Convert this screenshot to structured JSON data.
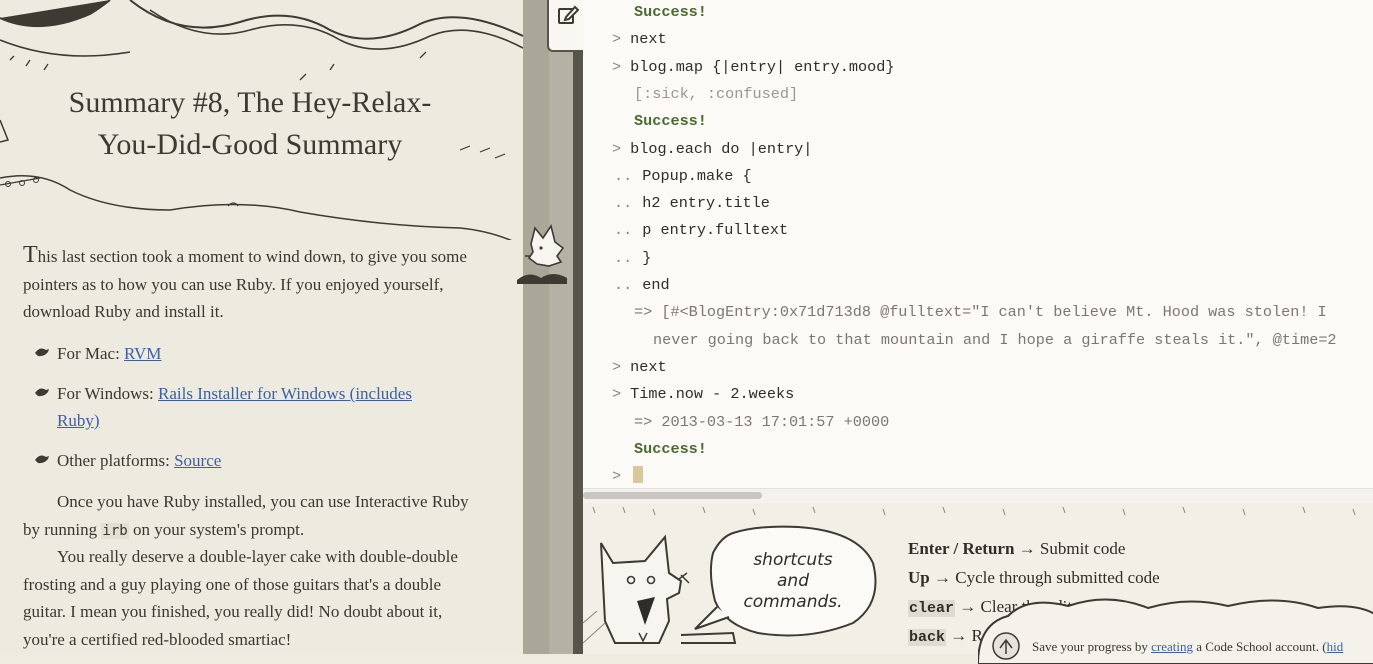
{
  "lesson": {
    "title_line1": "Summary #8, The Hey-Relax-",
    "title_line2": "You-Did-Good Summary",
    "intro_dropcap": "T",
    "intro_rest": "his last section took a moment to wind down, to give you some pointers as to how you can use Ruby. If you enjoyed yourself, download Ruby and install it.",
    "bullets": [
      {
        "prefix": "For Mac: ",
        "link": "RVM"
      },
      {
        "prefix": "For Windows: ",
        "link": "Rails Installer for Windows (includes Ruby)"
      },
      {
        "prefix": "Other platforms: ",
        "link": "Source"
      }
    ],
    "para2_before": "Once you have Ruby installed, you can use Interactive Ruby by running ",
    "para2_code": "irb",
    "para2_after": " on your system's prompt.",
    "para3": "You really deserve a double-layer cake with double-double frosting and a guy playing one of those guitars that's a double guitar. I mean you finished, you really did! No doubt about it, you're a certified red-blooded smartiac!"
  },
  "console": {
    "lines": [
      {
        "kind": "ok",
        "text": "Success!"
      },
      {
        "kind": "input",
        "prompt": ">",
        "text": "next"
      },
      {
        "kind": "input",
        "prompt": ">",
        "text": "blog.map {|entry| entry.mood}"
      },
      {
        "kind": "out",
        "text": "[:sick, :confused]"
      },
      {
        "kind": "ok",
        "text": "Success!"
      },
      {
        "kind": "input",
        "prompt": ">",
        "text": "blog.each do |entry|"
      },
      {
        "kind": "cont",
        "prompt": "..",
        "text": "Popup.make {"
      },
      {
        "kind": "cont",
        "prompt": "..",
        "text": "h2 entry.title"
      },
      {
        "kind": "cont",
        "prompt": "..",
        "text": "p entry.fulltext"
      },
      {
        "kind": "cont",
        "prompt": "..",
        "text": "}"
      },
      {
        "kind": "cont",
        "prompt": "..",
        "text": "end"
      },
      {
        "kind": "res",
        "text": "=> [#<BlogEntry:0x71d713d8 @fulltext=\"I can't believe Mt. Hood was stolen! I"
      },
      {
        "kind": "res2",
        "text": "never going back to that mountain and I hope a giraffe steals it.\", @time=2"
      },
      {
        "kind": "input",
        "prompt": ">",
        "text": "next"
      },
      {
        "kind": "input",
        "prompt": ">",
        "text": "Time.now - 2.weeks"
      },
      {
        "kind": "res",
        "text": "=> 2013-03-13 17:01:57 +0000"
      },
      {
        "kind": "ok",
        "text": "Success!"
      },
      {
        "kind": "input",
        "prompt": ">",
        "text": ""
      }
    ]
  },
  "help": {
    "bubble_line1": "shortcuts",
    "bubble_line2": "and",
    "bubble_line3": "commands.",
    "shortcuts": [
      {
        "key": "Enter / Return",
        "arrow": " → ",
        "desc": "Submit code",
        "style": "bold"
      },
      {
        "key": "Up",
        "arrow": " → ",
        "desc": "Cycle through submitted code",
        "style": "bold"
      },
      {
        "key": "clear",
        "arrow": " → ",
        "desc": "Clear the editor wi",
        "style": "code"
      },
      {
        "key": "back",
        "arrow": " → ",
        "desc": "R",
        "style": "code"
      }
    ]
  },
  "save_notice": {
    "before": "Save your progress by ",
    "link": "creating",
    "after": " a Code School account. (",
    "hide": "hid"
  },
  "icons": {
    "edit": "edit-icon",
    "paw": "paw-bullet-icon"
  }
}
